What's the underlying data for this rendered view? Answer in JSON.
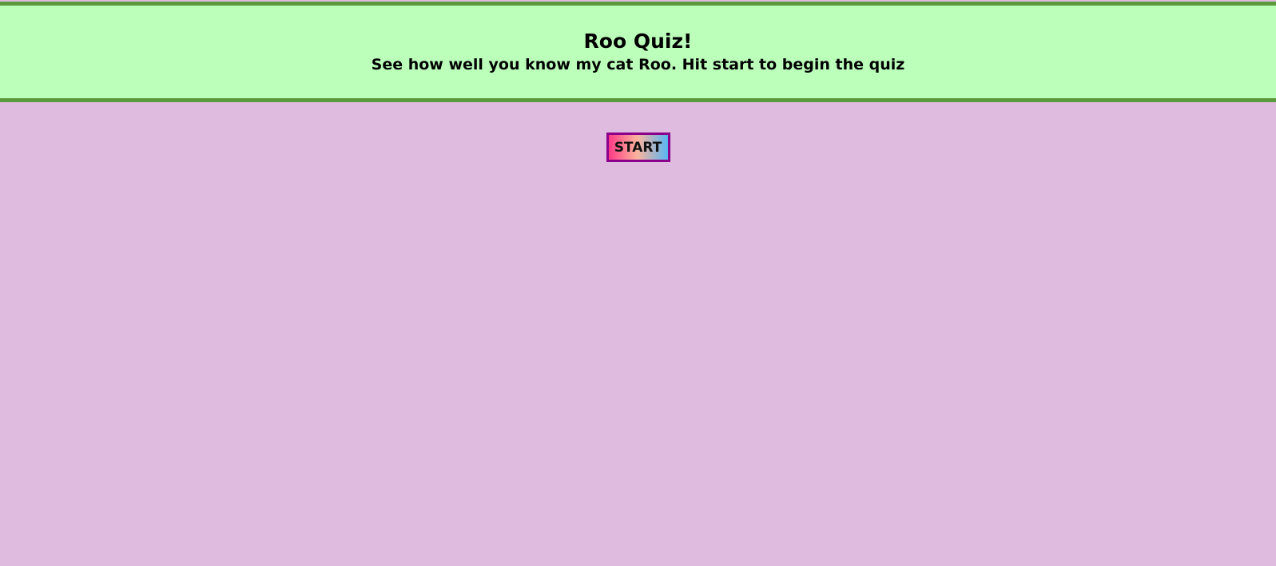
{
  "header": {
    "title": "Roo Quiz!",
    "subtitle": "See how well you know my cat Roo. Hit start to begin the quiz"
  },
  "main": {
    "start_label": "START"
  },
  "colors": {
    "background": "#dfbbdf",
    "header_background": "#bbffbb",
    "header_border": "#5b9a3c",
    "button_border": "#8a008a",
    "button_gradient_start": "#ff3b86",
    "button_gradient_mid": "#fbb49d",
    "button_gradient_end": "#58b5f3"
  }
}
